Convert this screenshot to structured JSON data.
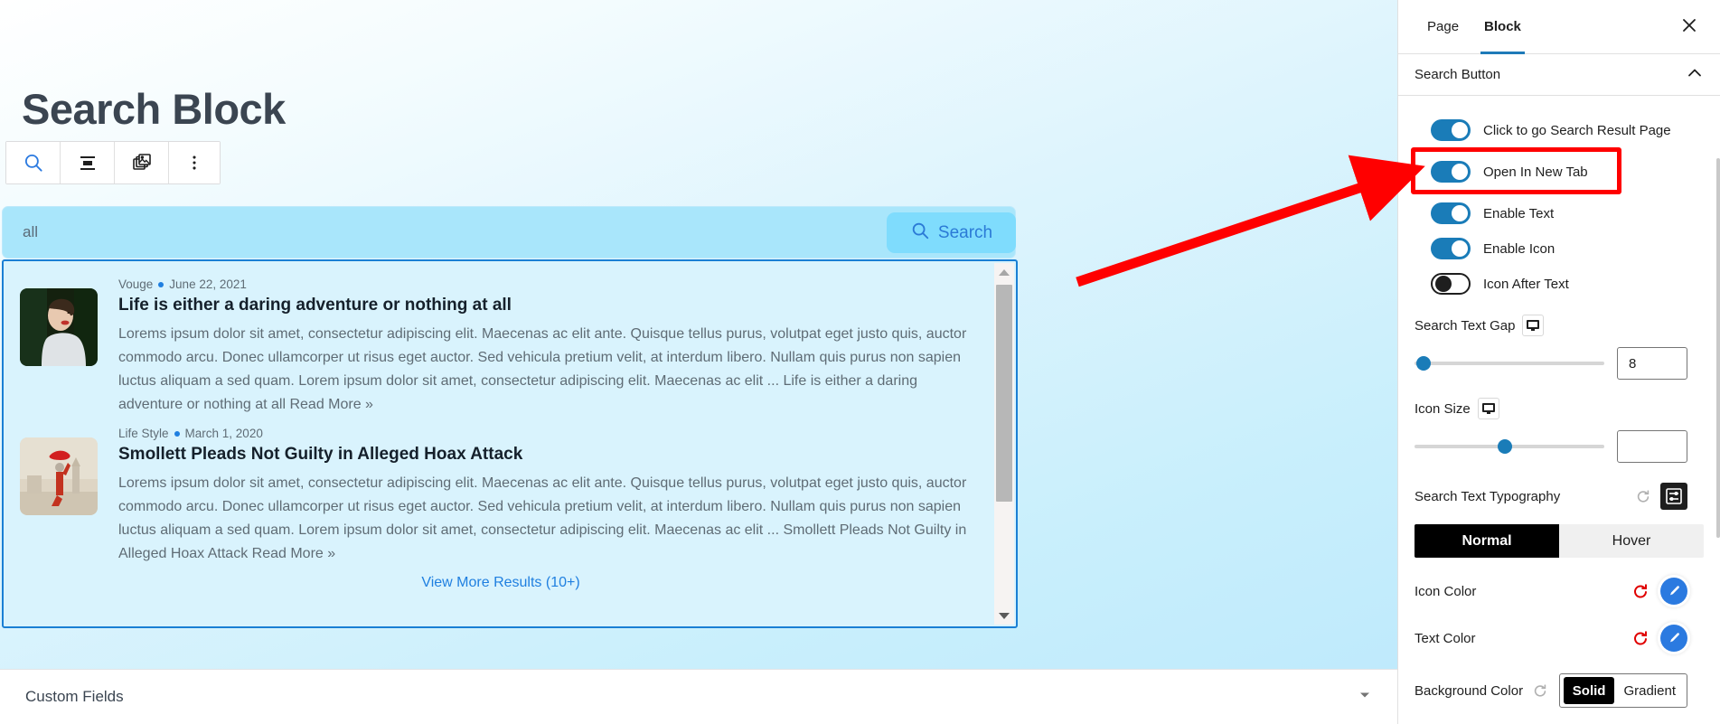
{
  "editor": {
    "page_title": "Search Block",
    "toolbar": {
      "buttons": [
        {
          "name": "search-block-icon",
          "label": "Search block"
        },
        {
          "name": "align-icon",
          "label": "Align"
        },
        {
          "name": "media-icon",
          "label": "Media"
        },
        {
          "name": "more-options-icon",
          "label": "Options"
        }
      ]
    },
    "search": {
      "value": "all",
      "placeholder": "all",
      "button_label": "Search"
    },
    "results": [
      {
        "category": "Vouge",
        "date": "June 22, 2021",
        "title": "Life is either a daring adventure or nothing at all",
        "excerpt": "Lorems ipsum dolor sit amet, consectetur adipiscing elit. Maecenas ac elit ante. Quisque tellus purus, volutpat eget justo quis, auctor commodo arcu. Donec ullamcorper ut risus eget auctor. Sed vehicula pretium velit, at interdum libero. Nullam quis purus non sapien luctus aliquam a sed quam. Lorem ipsum dolor sit amet, consectetur adipiscing elit. Maecenas ac elit ... Life is either a daring adventure or nothing at all Read More »"
      },
      {
        "category": "Life Style",
        "date": "March 1, 2020",
        "title": "Smollett Pleads Not Guilty in Alleged Hoax Attack",
        "excerpt": "Lorems ipsum dolor sit amet, consectetur adipiscing elit. Maecenas ac elit ante. Quisque tellus purus, volutpat eget justo quis, auctor commodo arcu. Donec ullamcorper ut risus eget auctor. Sed vehicula pretium velit, at interdum libero. Nullam quis purus non sapien luctus aliquam a sed quam. Lorem ipsum dolor sit amet, consectetur adipiscing elit. Maecenas ac elit ... Smollett Pleads Not Guilty in Alleged Hoax Attack Read More »"
      }
    ],
    "view_more_label": "View More Results (10+)",
    "custom_fields": {
      "label": "Custom Fields"
    }
  },
  "sidebar": {
    "tabs": [
      {
        "label": "Page",
        "active": false
      },
      {
        "label": "Block",
        "active": true
      }
    ],
    "close_label": "Close settings",
    "panel": {
      "title": "Search Button",
      "toggles": [
        {
          "label": "Click to go Search Result Page",
          "on": true
        },
        {
          "label": "Open In New Tab",
          "on": true
        },
        {
          "label": "Enable Text",
          "on": true
        },
        {
          "label": "Enable Icon",
          "on": true
        },
        {
          "label": "Icon After Text",
          "on": false
        }
      ],
      "search_text_gap": {
        "label": "Search Text Gap",
        "value": "8",
        "slider_percent": 6
      },
      "icon_size": {
        "label": "Icon Size",
        "value": "",
        "slider_percent": 47
      },
      "typography": {
        "label": "Search Text Typography"
      },
      "state_tabs": [
        {
          "label": "Normal",
          "active": true
        },
        {
          "label": "Hover",
          "active": false
        }
      ],
      "colors": [
        {
          "label": "Icon Color"
        },
        {
          "label": "Text Color"
        }
      ],
      "background_color": {
        "label": "Background Color",
        "options": [
          "Solid",
          "Gradient"
        ],
        "selected": "Solid"
      }
    }
  },
  "annotation": {
    "highlight_target": "Open In New Tab",
    "accent_color": "#ff0000"
  }
}
